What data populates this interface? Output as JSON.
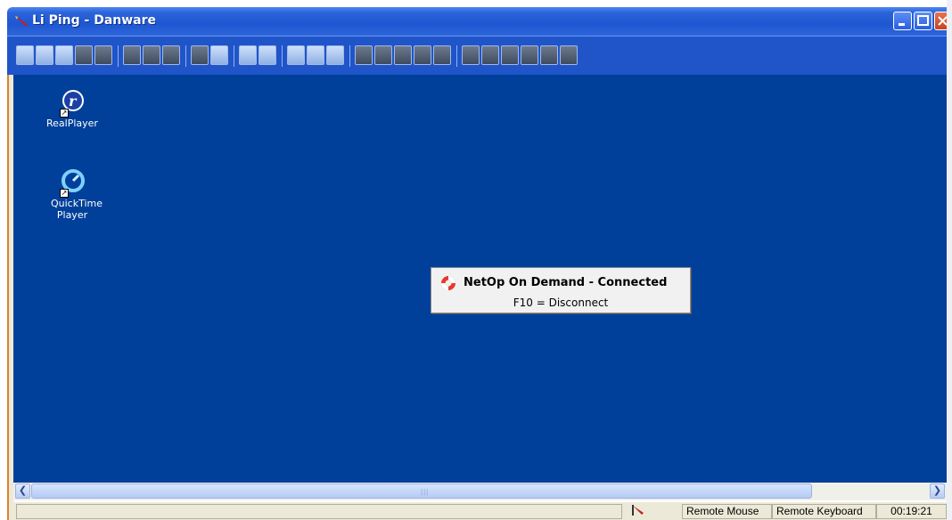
{
  "window": {
    "title": "Li Ping - Danware"
  },
  "desktop": {
    "icons": [
      {
        "label": "RealPlayer"
      },
      {
        "label": "QuickTime Player"
      }
    ]
  },
  "popup": {
    "title": "NetOp On Demand - Connected",
    "subtitle": "F10 = Disconnect"
  },
  "statusbar": {
    "remote_mouse": "Remote Mouse",
    "remote_keyboard": "Remote Keyboard",
    "time": "00:19:21"
  },
  "colors": {
    "desktop_bg": "#00409a",
    "titlebar": "#1f57d2",
    "toolbar": "#1f55c9"
  }
}
